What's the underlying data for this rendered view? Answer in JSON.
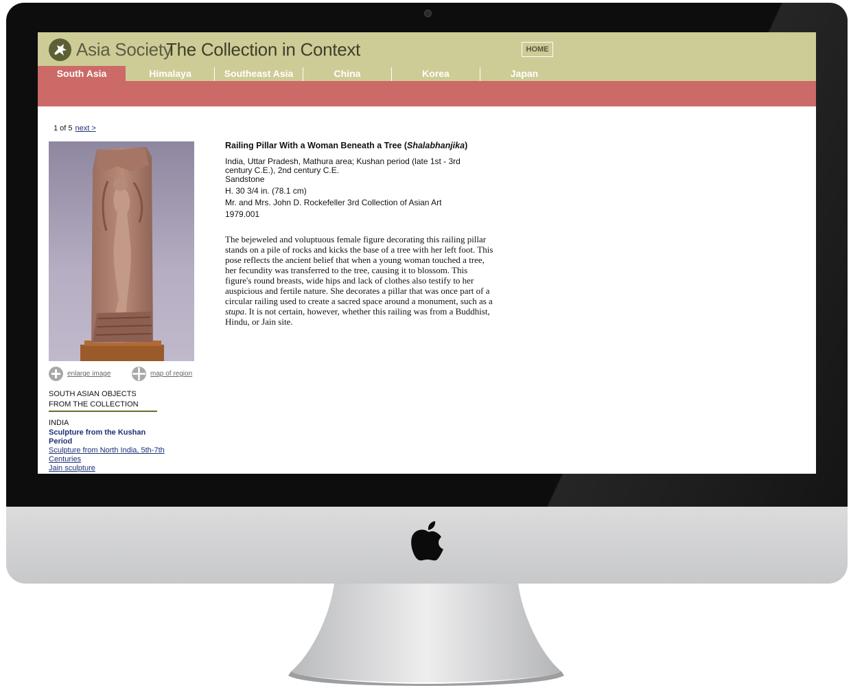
{
  "site": {
    "org_name": "Asia Society",
    "section_title": "The Collection in Context",
    "home_label": "HOME"
  },
  "tabs": [
    {
      "label": "South Asia",
      "active": true
    },
    {
      "label": "Himalaya",
      "active": false
    },
    {
      "label": "Southeast Asia",
      "active": false
    },
    {
      "label": "China",
      "active": false
    },
    {
      "label": "Korea",
      "active": false
    },
    {
      "label": "Japan",
      "active": false
    }
  ],
  "colors": {
    "header_bg": "#cdcc96",
    "accent_red": "#cc6a67",
    "link_blue": "#1f2f77"
  },
  "pager": {
    "position": "1 of 5",
    "next_label": "next >"
  },
  "artwork": {
    "title": "Railing Pillar With a Woman Beneath a Tree",
    "title_italic": "Shalabhanjika",
    "origin": "India, Uttar Pradesh, Mathura area; Kushan period (late 1st - 3rd century C.E.), 2nd century C.E.",
    "medium": "Sandstone",
    "dimensions": "H. 30 3/4 in. (78.1 cm)",
    "credit": "Mr. and Mrs. John D. Rockefeller 3rd Collection of Asian Art",
    "accession": "1979.001",
    "description_part1": "The bejeweled and voluptuous female figure decorating this railing pillar stands on a pile of rocks and kicks the base of a tree with her left foot. This pose reflects the ancient belief that when a young woman touched a tree, her fecundity was transferred to the tree, causing it to blossom. This figure's round breasts, wide hips and lack of clothes also testify to her auspicious and fertile nature. She decorates a pillar that was once part of a circular railing used to create a sacred space around a monument, such as a",
    "description_italic": "stupa",
    "description_part2": ". It is not certain, however, whether this railing was from a Buddhist, Hindu, or Jain site."
  },
  "image_tools": {
    "enlarge_label": "enlarge image",
    "map_label": "map of region"
  },
  "sidebar": {
    "heading_line1": "SOUTH ASIAN OBJECTS",
    "heading_line2": "FROM THE COLLECTION",
    "category": "INDIA",
    "current_item": "Sculpture from the Kushan Period",
    "links": [
      "Sculpture from North India, 5th-7th Centuries",
      "Jain sculpture"
    ]
  }
}
